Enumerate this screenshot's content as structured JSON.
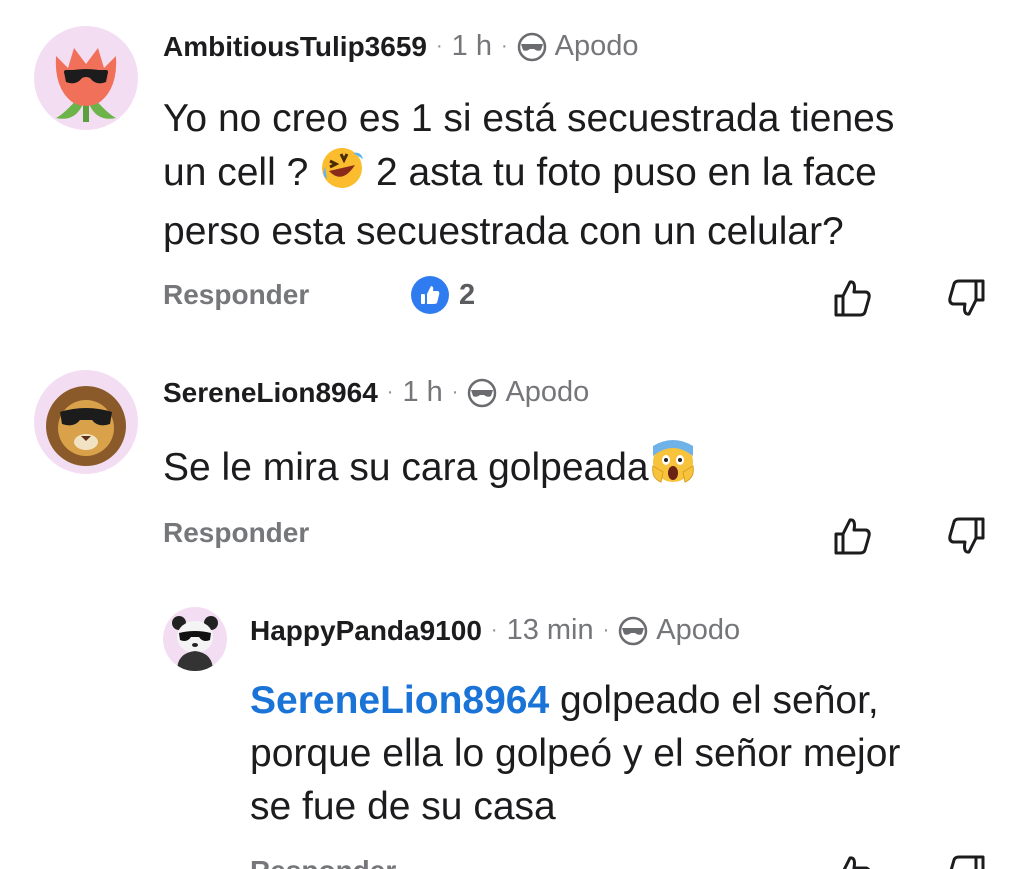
{
  "comments": [
    {
      "username": "AmbitiousTulip3659",
      "time": "1 h",
      "tag": "Apodo",
      "avatar": "tulip-avatar",
      "lines": [
        "Yo no creo es 1 si está secuestrada tienes",
        "un cell ? ",
        " 2 asta tu foto puso en la face",
        "perso esta secuestrada con un celular?"
      ],
      "emoji": "rolling-laughing-emoji",
      "reply_label": "Responder",
      "like_count": "2"
    },
    {
      "username": "SereneLion8964",
      "time": "1 h",
      "tag": "Apodo",
      "avatar": "lion-avatar",
      "text": "Se le mira su cara golpeada",
      "emoji": "screaming-face-emoji",
      "reply_label": "Responder"
    },
    {
      "username": "HappyPanda9100",
      "time": "13 min",
      "tag": "Apodo",
      "avatar": "panda-avatar",
      "mention": "SereneLion8964",
      "lines": [
        " golpeado el señor,",
        "porque ella lo golpeó y el señor mejor",
        "se fue de su casa"
      ],
      "reply_label": "Responder"
    }
  ],
  "icons": {
    "mask": "sunglasses-mask-icon",
    "like": "thumbs-up-icon",
    "dislike": "thumbs-down-icon",
    "like_badge": "like-badge-icon"
  },
  "colors": {
    "mention": "#1a73d6",
    "like_badge": "#2f7cf0",
    "avatar_bg": "#f3ddf2"
  }
}
